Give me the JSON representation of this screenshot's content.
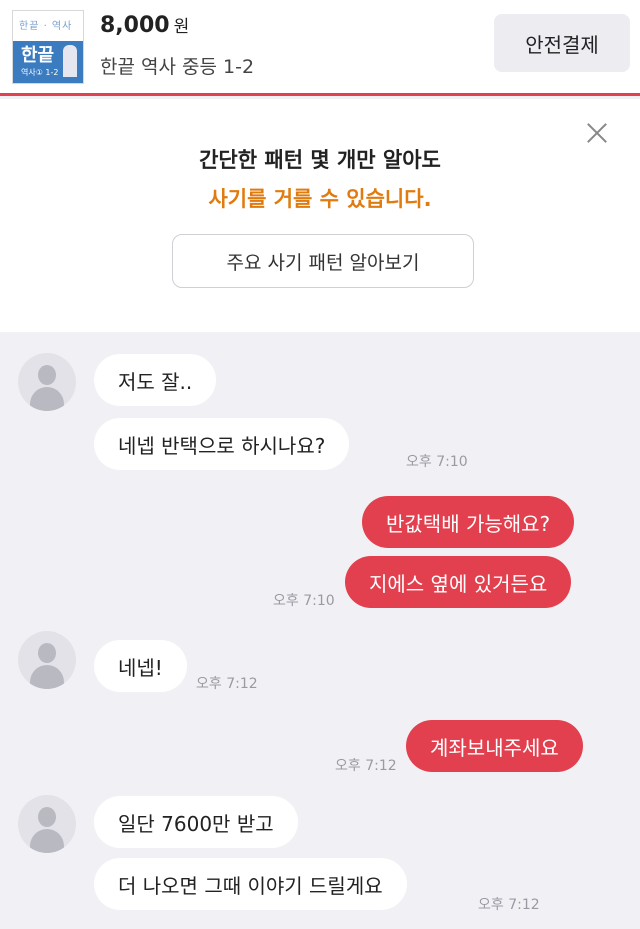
{
  "product": {
    "thumbnail_title": "한끝",
    "thumbnail_top_text": "한끝 · 역사",
    "thumbnail_bottom_text": "역사① 1-2",
    "price": "8,000",
    "currency": "원",
    "title": "한끝 역사 중등 1-2",
    "pay_button": "안전결제"
  },
  "notice": {
    "line1": "간단한 패턴 몇 개만 알아도",
    "line2": "사기를 거를 수 있습니다.",
    "button": "주요 사기 패턴 알아보기",
    "accent_color": "#e07b0f"
  },
  "colors": {
    "outgoing_bubble": "#e2404e",
    "incoming_bubble": "#ffffff",
    "background": "#f1f1f5"
  },
  "messages": [
    {
      "side": "in",
      "text": "저도 잘..",
      "time": ""
    },
    {
      "side": "in",
      "text": "네넵 반택으로 하시나요?",
      "time": "오후 7:10"
    },
    {
      "side": "out",
      "text": "반값택배 가능해요?",
      "time": ""
    },
    {
      "side": "out",
      "text": "지에스 옆에 있거든요",
      "time": "오후 7:10"
    },
    {
      "side": "in",
      "text": "네넵!",
      "time": "오후 7:12"
    },
    {
      "side": "out",
      "text": "계좌보내주세요",
      "time": "오후 7:12"
    },
    {
      "side": "in",
      "text": "일단 7600만 받고",
      "time": ""
    },
    {
      "side": "in",
      "text": "더 나오면 그때 이야기 드릴게요",
      "time": "오후 7:12"
    }
  ]
}
